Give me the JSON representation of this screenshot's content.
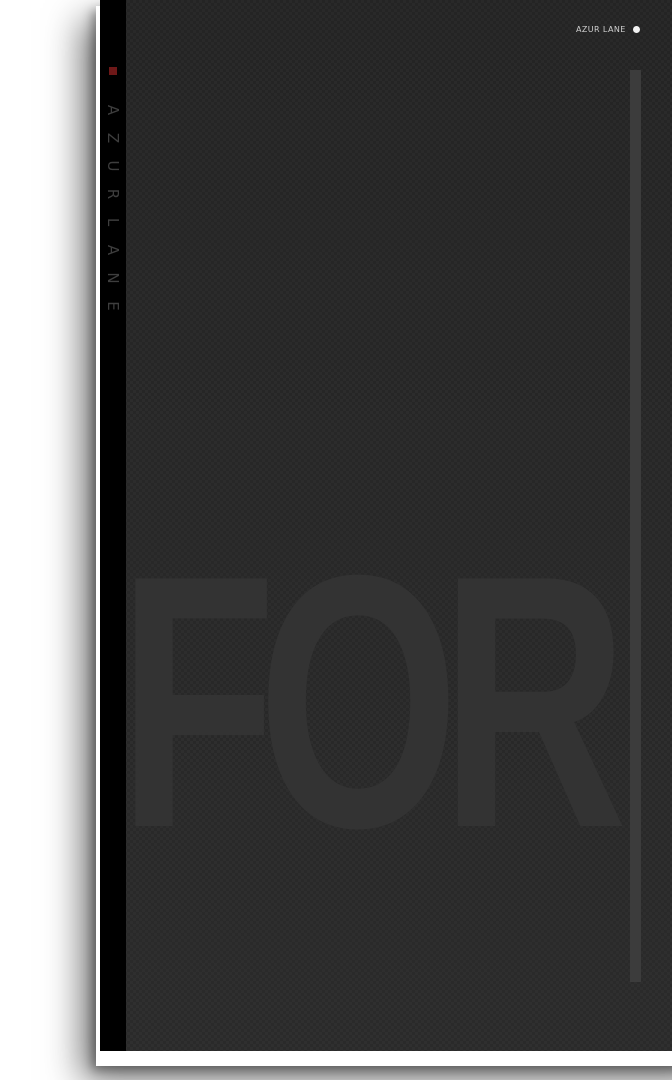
{
  "spine": {
    "letters": [
      "A",
      "Z",
      "U",
      "R",
      "L",
      "A",
      "N",
      "E"
    ]
  },
  "header": {
    "brand": "AZUR LANE"
  },
  "background": {
    "word": "FOR"
  },
  "colors": {
    "card": "#262626",
    "spine": "#000000",
    "accent": "#6e1818",
    "divider": "#3c3c3c"
  }
}
